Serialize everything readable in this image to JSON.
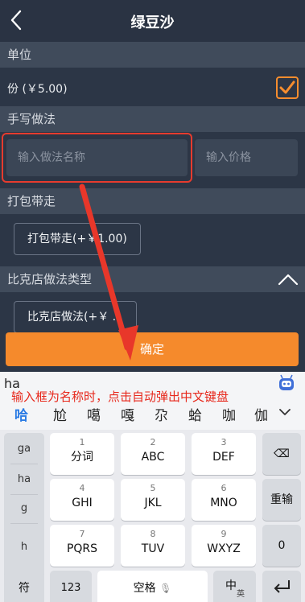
{
  "header": {
    "title": "绿豆沙"
  },
  "sections": {
    "unit": "单位",
    "handwritten": "手写做法",
    "takeaway": "打包带走",
    "bike": "比克店做法类型"
  },
  "unit_row": {
    "label": "份 (￥5.00)",
    "checked": true
  },
  "handwritten_inputs": {
    "name_placeholder": "输入做法名称",
    "price_placeholder": "输入价格"
  },
  "takeaway_chip": "打包带走(+￥1.00)",
  "bike_chip": "比克店做法(+￥ ...",
  "confirm_label": "确定",
  "keyboard": {
    "pinyin": "ha",
    "annotation": "输入框为名称时，点击自动弹出中文键盘",
    "candidates": [
      "哈",
      "尬",
      "噶",
      "嘎",
      "尕",
      "蛤",
      "咖",
      "伽"
    ],
    "side_keys": [
      "ga",
      "ha",
      "g",
      "h"
    ],
    "keys": [
      {
        "num": "1",
        "letters": "分词"
      },
      {
        "num": "2",
        "letters": "ABC"
      },
      {
        "num": "3",
        "letters": "DEF"
      },
      {
        "num": "4",
        "letters": "GHI"
      },
      {
        "num": "5",
        "letters": "JKL"
      },
      {
        "num": "6",
        "letters": "MNO"
      },
      {
        "num": "7",
        "letters": "PQRS"
      },
      {
        "num": "8",
        "letters": "TUV"
      },
      {
        "num": "9",
        "letters": "WXYZ"
      }
    ],
    "right_keys": {
      "backspace": "⌫",
      "retype": "重输",
      "zero": "0"
    },
    "bottom": {
      "symbol": "符",
      "num123": "123",
      "space": "空格",
      "lang_main": "中",
      "lang_sub": "英"
    }
  },
  "colors": {
    "accent": "#f58a2c",
    "highlight": "#e63b2e",
    "candidate": "#2a7be4"
  }
}
